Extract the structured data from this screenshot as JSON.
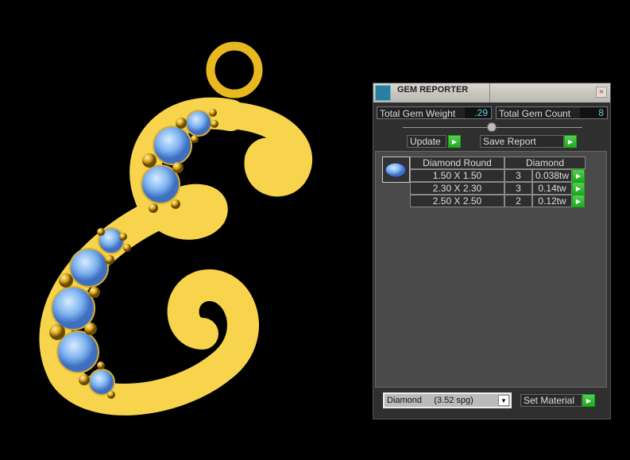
{
  "window": {
    "title": "GEM REPORTER",
    "close": "×"
  },
  "totals": {
    "weight_label": "Total Gem Weight",
    "weight_value": ".29",
    "count_label": "Total Gem Count",
    "count_value": "8"
  },
  "buttons": {
    "update": "Update",
    "save_report": "Save Report",
    "set_material": "Set Material",
    "go": "▶"
  },
  "table": {
    "headers": [
      "Diamond Round",
      "Diamond"
    ],
    "rows": [
      {
        "size": "1.50 X 1.50",
        "count": "3",
        "weight": "0.038tw"
      },
      {
        "size": "2.30 X 2.30",
        "count": "3",
        "weight": "0.14tw"
      },
      {
        "size": "2.50 X 2.50",
        "count": "2",
        "weight": "0.12tw"
      }
    ]
  },
  "material": {
    "selected": "Diamond     (3.52 spg)",
    "arrow": "▼"
  },
  "colors": {
    "gold": "#f8d44c",
    "gem": "#7fb3f0",
    "accent": "#3ab53a"
  }
}
